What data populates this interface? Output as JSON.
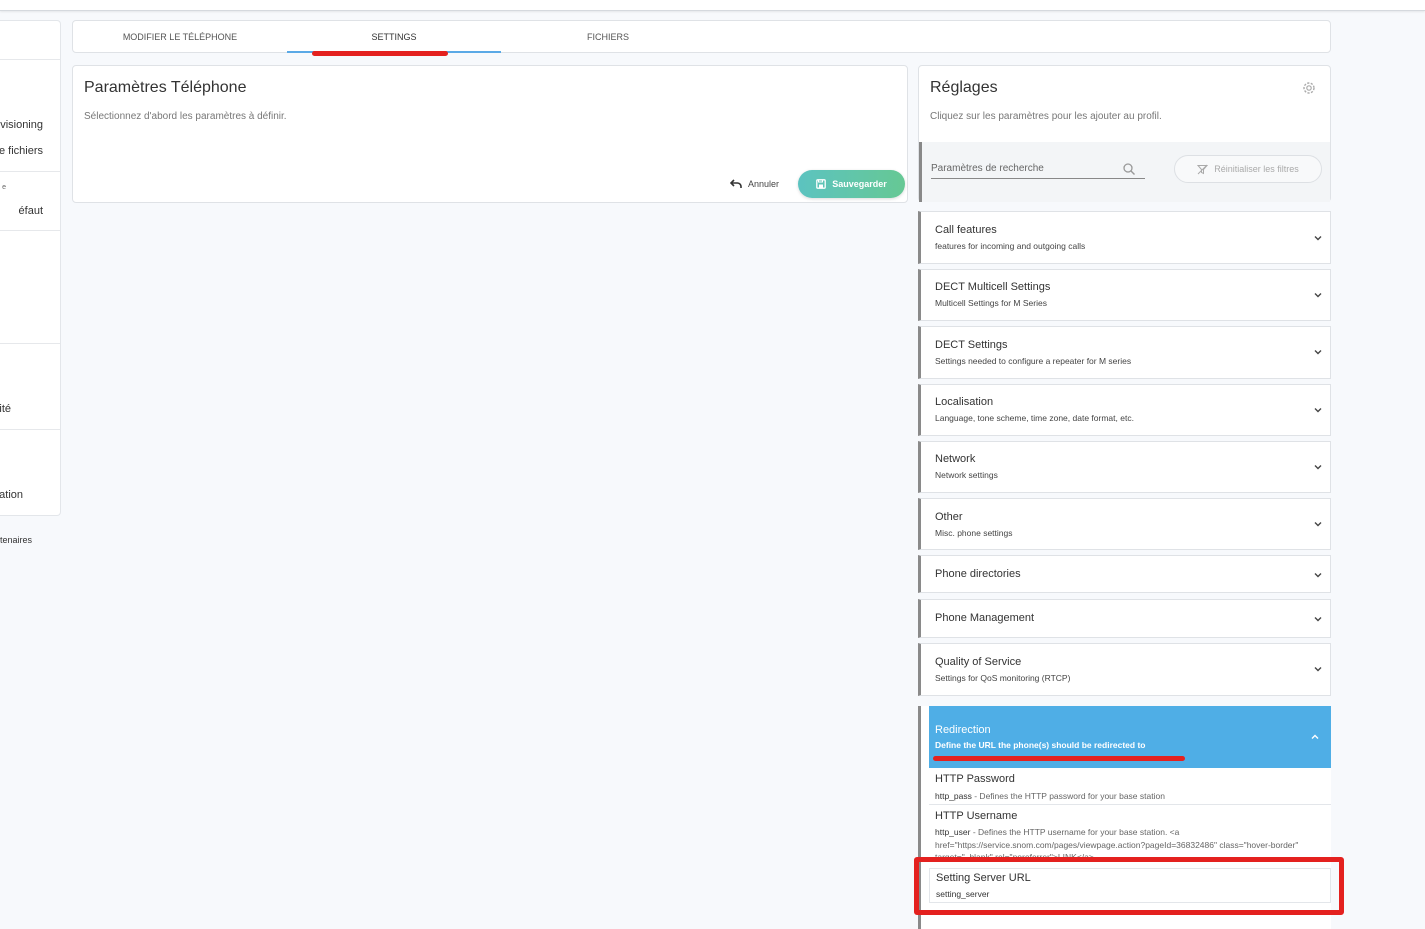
{
  "sidebar": {
    "items": [
      "visioning",
      "e fichiers",
      "e",
      "éfaut",
      "ité",
      "ation"
    ],
    "footer": "tenaires"
  },
  "tabs": [
    {
      "label": "MODIFIER LE TÉLÉPHONE"
    },
    {
      "label": "SETTINGS"
    },
    {
      "label": "FICHIERS"
    }
  ],
  "phone_params": {
    "title": "Paramètres Téléphone",
    "subtitle": "Sélectionnez d'abord les paramètres à définir.",
    "cancel_label": "Annuler",
    "save_label": "Sauvegarder"
  },
  "settings_panel": {
    "title": "Réglages",
    "subtitle": "Cliquez sur les paramètres pour les ajouter au profil.",
    "search_placeholder": "Paramètres de recherche",
    "reset_label": "Réinitialiser les filtres"
  },
  "categories": [
    {
      "title": "Call features",
      "subtitle": "features for incoming and outgoing calls"
    },
    {
      "title": "DECT Multicell Settings",
      "subtitle": "Multicell Settings for M Series"
    },
    {
      "title": "DECT Settings",
      "subtitle": "Settings needed to configure a repeater for M series"
    },
    {
      "title": "Localisation",
      "subtitle": "Language, tone scheme, time zone, date format, etc."
    },
    {
      "title": "Network",
      "subtitle": "Network settings"
    },
    {
      "title": "Other",
      "subtitle": "Misc. phone settings"
    },
    {
      "title": "Phone directories",
      "subtitle": ""
    },
    {
      "title": "Phone Management",
      "subtitle": ""
    },
    {
      "title": "Quality of Service",
      "subtitle": "Settings for QoS monitoring (RTCP)"
    }
  ],
  "redirection": {
    "title": "Redirection",
    "subtitle": "Define the URL the phone(s) should be redirected to",
    "items": [
      {
        "title": "HTTP Password",
        "key": "http_pass",
        "desc": " - Defines the HTTP password for your base station"
      },
      {
        "title": "HTTP Username",
        "key": "http_user",
        "desc": " - Defines the HTTP username for your base station. <a href=\"https://service.snom.com/pages/viewpage.action?pageId=36832486\" class=\"hover-border\" target=\"_blank\" rel=\"noreferrer\">LINK</a>"
      },
      {
        "title": "Setting Server URL",
        "key": "setting_server",
        "desc": ""
      }
    ]
  },
  "colors": {
    "accent_blue": "#4faee6",
    "save_green": "#5cc3c0",
    "annotation_red": "#e4211f"
  }
}
